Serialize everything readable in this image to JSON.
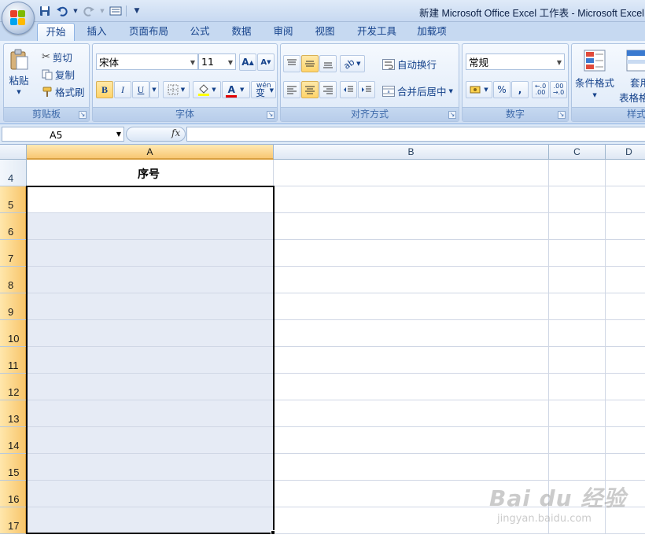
{
  "window": {
    "title": "新建 Microsoft Office Excel 工作表 - Microsoft Excel"
  },
  "qat": {
    "icons": [
      "save-icon",
      "undo-icon",
      "redo-icon",
      "print-preview-icon",
      "customize-qat-icon"
    ]
  },
  "tabs": [
    "开始",
    "插入",
    "页面布局",
    "公式",
    "数据",
    "审阅",
    "视图",
    "开发工具",
    "加载项"
  ],
  "ribbon": {
    "clipboard": {
      "paste": "粘贴",
      "cut": "剪切",
      "copy": "复制",
      "format_painter": "格式刷",
      "label": "剪贴板"
    },
    "font": {
      "name": "宋体",
      "size": "11",
      "bold": "B",
      "italic": "I",
      "underline": "U",
      "label": "字体",
      "grow": "A",
      "shrink": "A",
      "font_color_glyph": "A",
      "phonetic": "变"
    },
    "alignment": {
      "wrap": "自动换行",
      "merge": "合并后居中",
      "label": "对齐方式"
    },
    "number": {
      "format": "常规",
      "percent": "%",
      "comma": ",",
      "label": "数字",
      "inc_decimal": "←.0 .00",
      "dec_decimal": ".00 →.0"
    },
    "styles": {
      "conditional": "条件格式",
      "table_format_1": "套用",
      "table_format_2": "表格格",
      "label": "样式"
    }
  },
  "formula_bar": {
    "name_box": "A5",
    "fx": "fx",
    "value": ""
  },
  "sheet": {
    "columns": [
      "A",
      "B",
      "C",
      "D"
    ],
    "rows": [
      "4",
      "5",
      "6",
      "7",
      "8",
      "9",
      "10",
      "11",
      "12",
      "13",
      "14",
      "15",
      "16",
      "17"
    ],
    "cells": {
      "A4": "序号"
    },
    "selected_range": "A5:A17",
    "active_cell": "A5"
  },
  "watermark": {
    "brand": "Bai du 经验",
    "url": "jingyan.baidu.com"
  }
}
